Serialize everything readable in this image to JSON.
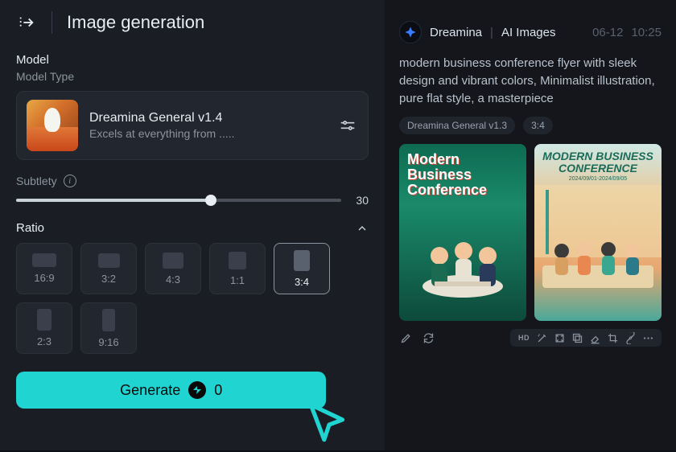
{
  "panel": {
    "title": "Image generation",
    "model_section": "Model",
    "model_type": "Model Type",
    "model": {
      "name": "Dreamina General v1.4",
      "desc": "Excels at everything from ....."
    },
    "subtlety_label": "Subtlety",
    "subtlety_value": "30",
    "ratio_label": "Ratio",
    "ratios": {
      "r169": "16:9",
      "r32": "3:2",
      "r43": "4:3",
      "r11": "1:1",
      "r34": "3:4",
      "r23": "2:3",
      "r916": "9:16"
    },
    "generate_label": "Generate",
    "generate_cost": "0"
  },
  "feed": {
    "brand": "Dreamina",
    "category": "AI Images",
    "date": "06-12",
    "time": "10:25",
    "prompt": "modern business conference flyer with sleek design and vibrant colors, Minimalist illustration, pure flat style, a masterpiece",
    "tag_model": "Dreamina General v1.3",
    "tag_ratio": "3:4",
    "poster_a_l1": "Modern",
    "poster_a_l2": "Business",
    "poster_a_l3": "Conference",
    "poster_b_l1": "MODERN BUSINESS",
    "poster_b_l2": "CONFERENCE",
    "poster_b_sub": "2024/09/01-2024/09/05",
    "hd": "HD"
  }
}
